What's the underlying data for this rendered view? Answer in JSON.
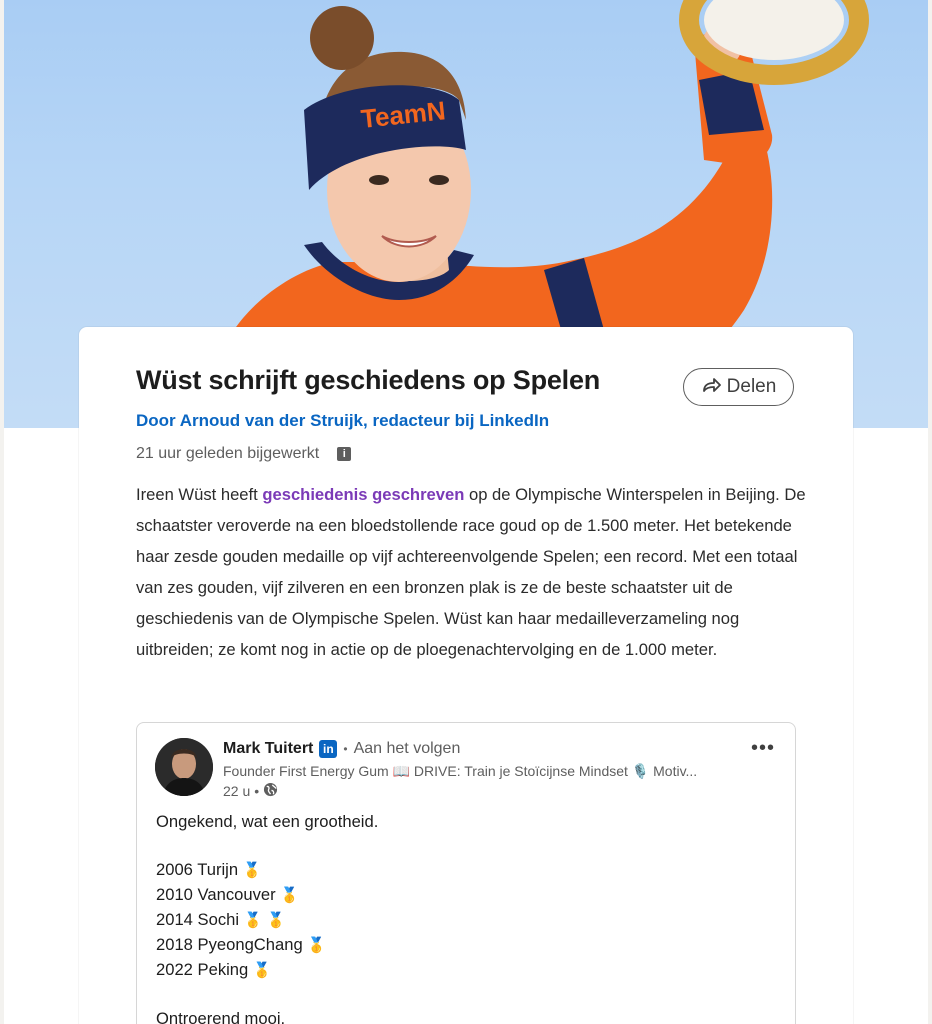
{
  "article": {
    "title": "Wüst schrijft geschiedens op Spelen",
    "share_label": "Delen",
    "byline": "Door Arnoud van der Struijk, redacteur bij LinkedIn",
    "updated": "21 uur geleden bijgewerkt",
    "body_before_link": "Ireen Wüst heeft ",
    "body_link": "geschiedenis geschreven",
    "body_after_link": " op de Olympische Winterspelen in Beijing. De schaatster veroverde na een bloedstollende race goud op de 1.500 meter. Het betekende haar zesde gouden medaille op vijf achtereenvolgende Spelen; een record. Met een totaal van zes gouden, vijf zilveren en een bronzen plak is ze de beste schaatster uit de geschiedenis van de Olympische Spelen. Wüst kan haar medailleverzameling nog uitbreiden; ze komt nog in actie op de ploegenachtervolging en de 1.000 meter."
  },
  "hero": {
    "headband_text": "TeamN",
    "icon": "hero-photo"
  },
  "post": {
    "author_name": "Mark Tuitert",
    "linkedin_badge": "in",
    "follow_status": "Aan het volgen",
    "headline": "Founder First Energy Gum 📖 DRIVE: Train je Stoïcijnse Mindset 🎙️ Motiv...",
    "time": "22 u",
    "intro": "Ongekend, wat een grootheid.",
    "lines": [
      {
        "text": "2006 Turijn",
        "medals": "🥇"
      },
      {
        "text": "2010 Vancouver",
        "medals": "🥇"
      },
      {
        "text": "2014 Sochi",
        "medals": "🥇 🥇"
      },
      {
        "text": "2018 PyeongChang",
        "medals": "🥇"
      },
      {
        "text": "2022 Peking",
        "medals": "🥇"
      }
    ],
    "outro": "Ontroerend mooi."
  },
  "colors": {
    "link_blue": "#0a66c2",
    "link_purple": "#7b3ab7",
    "jersey_orange": "#f2661e",
    "navy": "#1d2a5c"
  }
}
